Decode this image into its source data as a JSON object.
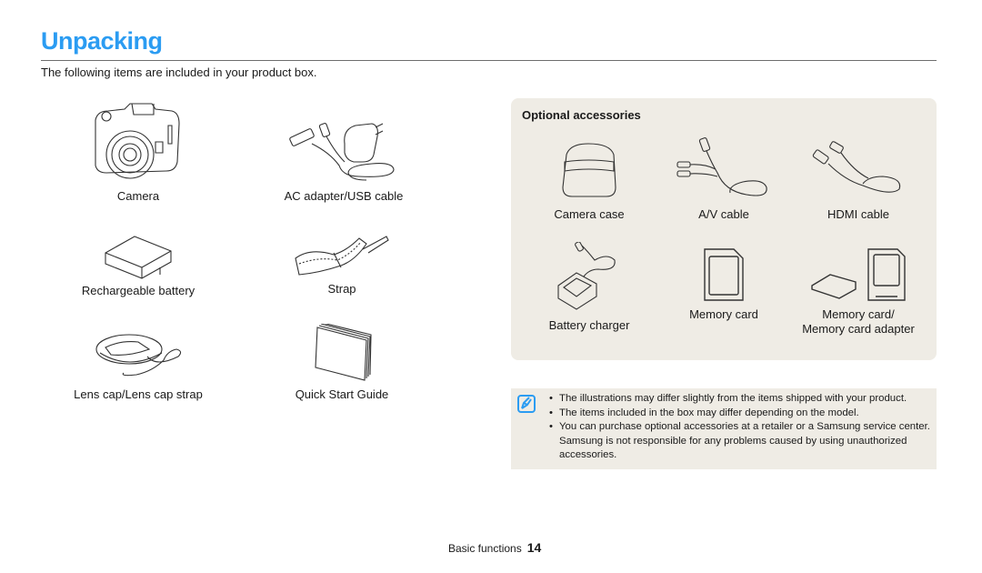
{
  "page": {
    "title": "Unpacking",
    "intro": "The following items are included in your product box."
  },
  "included_items": [
    {
      "label": "Camera",
      "icon": "camera-icon"
    },
    {
      "label": "AC adapter/USB cable",
      "icon": "ac-adapter-usb-cable-icon"
    },
    {
      "label": "Rechargeable battery",
      "icon": "battery-icon"
    },
    {
      "label": "Strap",
      "icon": "strap-icon"
    },
    {
      "label": "Lens cap/Lens cap strap",
      "icon": "lens-cap-icon"
    },
    {
      "label": "Quick Start Guide",
      "icon": "quick-start-guide-icon"
    }
  ],
  "optional_accessories": {
    "title": "Optional accessories",
    "items": [
      {
        "label": "Camera case",
        "icon": "camera-case-icon"
      },
      {
        "label": "A/V cable",
        "icon": "av-cable-icon"
      },
      {
        "label": "HDMI cable",
        "icon": "hdmi-cable-icon"
      },
      {
        "label": "Battery charger",
        "icon": "battery-charger-icon"
      },
      {
        "label": "Memory card",
        "icon": "memory-card-icon"
      },
      {
        "label": "Memory card/",
        "label2": "Memory card adapter",
        "icon": "memory-card-adapter-icon"
      }
    ]
  },
  "note": {
    "icon": "note-pencil-icon",
    "bullets": [
      "The illustrations may differ slightly from the items shipped with your product.",
      "The items included in the box may differ depending on the model.",
      "You can purchase optional accessories at a retailer or a Samsung service center. Samsung is not responsible for any problems caused by using unauthorized accessories."
    ]
  },
  "footer": {
    "section": "Basic functions",
    "page_number": "14"
  },
  "colors": {
    "title": "#2b9cf2",
    "panel_bg": "#efece5",
    "note_icon": "#2b9cf2"
  }
}
